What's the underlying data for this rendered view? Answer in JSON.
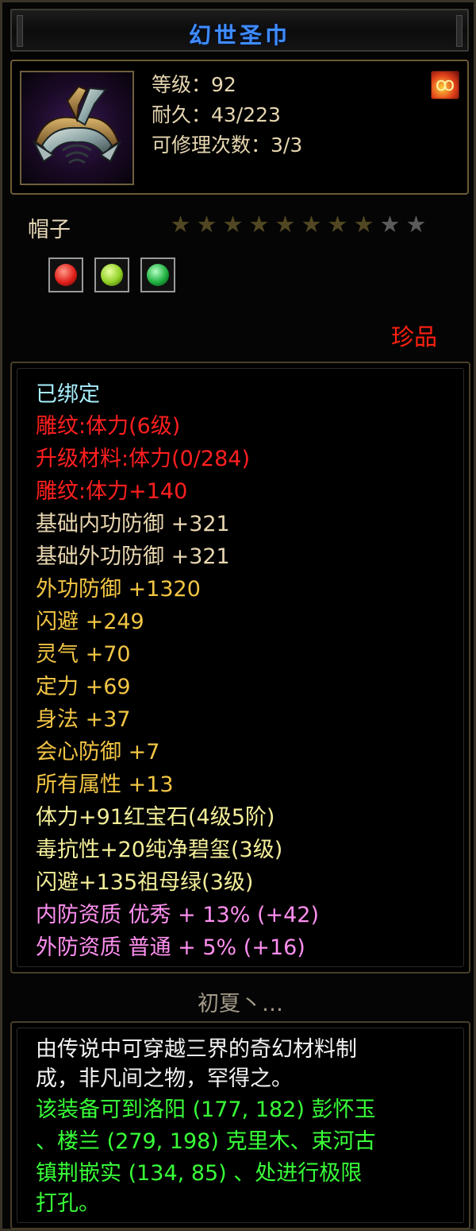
{
  "title": "幻世圣巾",
  "header": {
    "level": "等级：92",
    "durability": "耐久：43/223",
    "repair": "可修理次数：3/3",
    "item_icon": "headscarf-item-icon",
    "corner_icon": "fire-emblem-icon"
  },
  "item_type": "帽子",
  "stars": {
    "filled": 8,
    "total": 10
  },
  "gems": [
    {
      "icon": "red-gem-icon",
      "color": "#e0201a"
    },
    {
      "icon": "green-gem-icon",
      "color": "#8fd024"
    },
    {
      "icon": "emerald-gem-icon",
      "color": "#1fb040"
    }
  ],
  "rarity": "珍品",
  "attributes": [
    {
      "text": "已绑定",
      "kind": "bound"
    },
    {
      "text": "雕纹:体力(6级)",
      "kind": "red"
    },
    {
      "text": "升级材料:体力(0/284)",
      "kind": "red"
    },
    {
      "text": "雕纹:体力+140",
      "kind": "red"
    },
    {
      "text": "基础内功防御 +321",
      "kind": "base"
    },
    {
      "text": "基础外功防御 +321",
      "kind": "base"
    },
    {
      "text": "外功防御 +1320",
      "kind": "gold"
    },
    {
      "text": "闪避 +249",
      "kind": "gold"
    },
    {
      "text": "灵气 +70",
      "kind": "gold"
    },
    {
      "text": "定力 +69",
      "kind": "gold"
    },
    {
      "text": "身法 +37",
      "kind": "gold"
    },
    {
      "text": "会心防御 +7",
      "kind": "gold"
    },
    {
      "text": "所有属性 +13",
      "kind": "gold"
    },
    {
      "text": "体力+91红宝石(4级5阶)",
      "kind": "gem"
    },
    {
      "text": "毒抗性+20纯净碧玺(3级)",
      "kind": "gem"
    },
    {
      "text": "闪避+135祖母绿(3级)",
      "kind": "gem"
    },
    {
      "text": "内防资质 优秀 + 13% (+42)",
      "kind": "pink"
    },
    {
      "text": "外防资质 普通 + 5% (+16)",
      "kind": "pink"
    }
  ],
  "owner": "初夏丶…",
  "description": [
    {
      "text": "由传说中可穿越三界的奇幻材料制",
      "kind": "white"
    },
    {
      "text": "成，非凡间之物，罕得之。",
      "kind": "white"
    },
    {
      "text": "该装备可到洛阳 (177, 182) 彭怀玉",
      "kind": "green"
    },
    {
      "text": "、楼兰 (279, 198) 克里木、束河古",
      "kind": "green"
    },
    {
      "text": "镇荆嵌实 (134, 85) 、处进行极限",
      "kind": "green"
    },
    {
      "text": "打孔。",
      "kind": "green"
    }
  ]
}
